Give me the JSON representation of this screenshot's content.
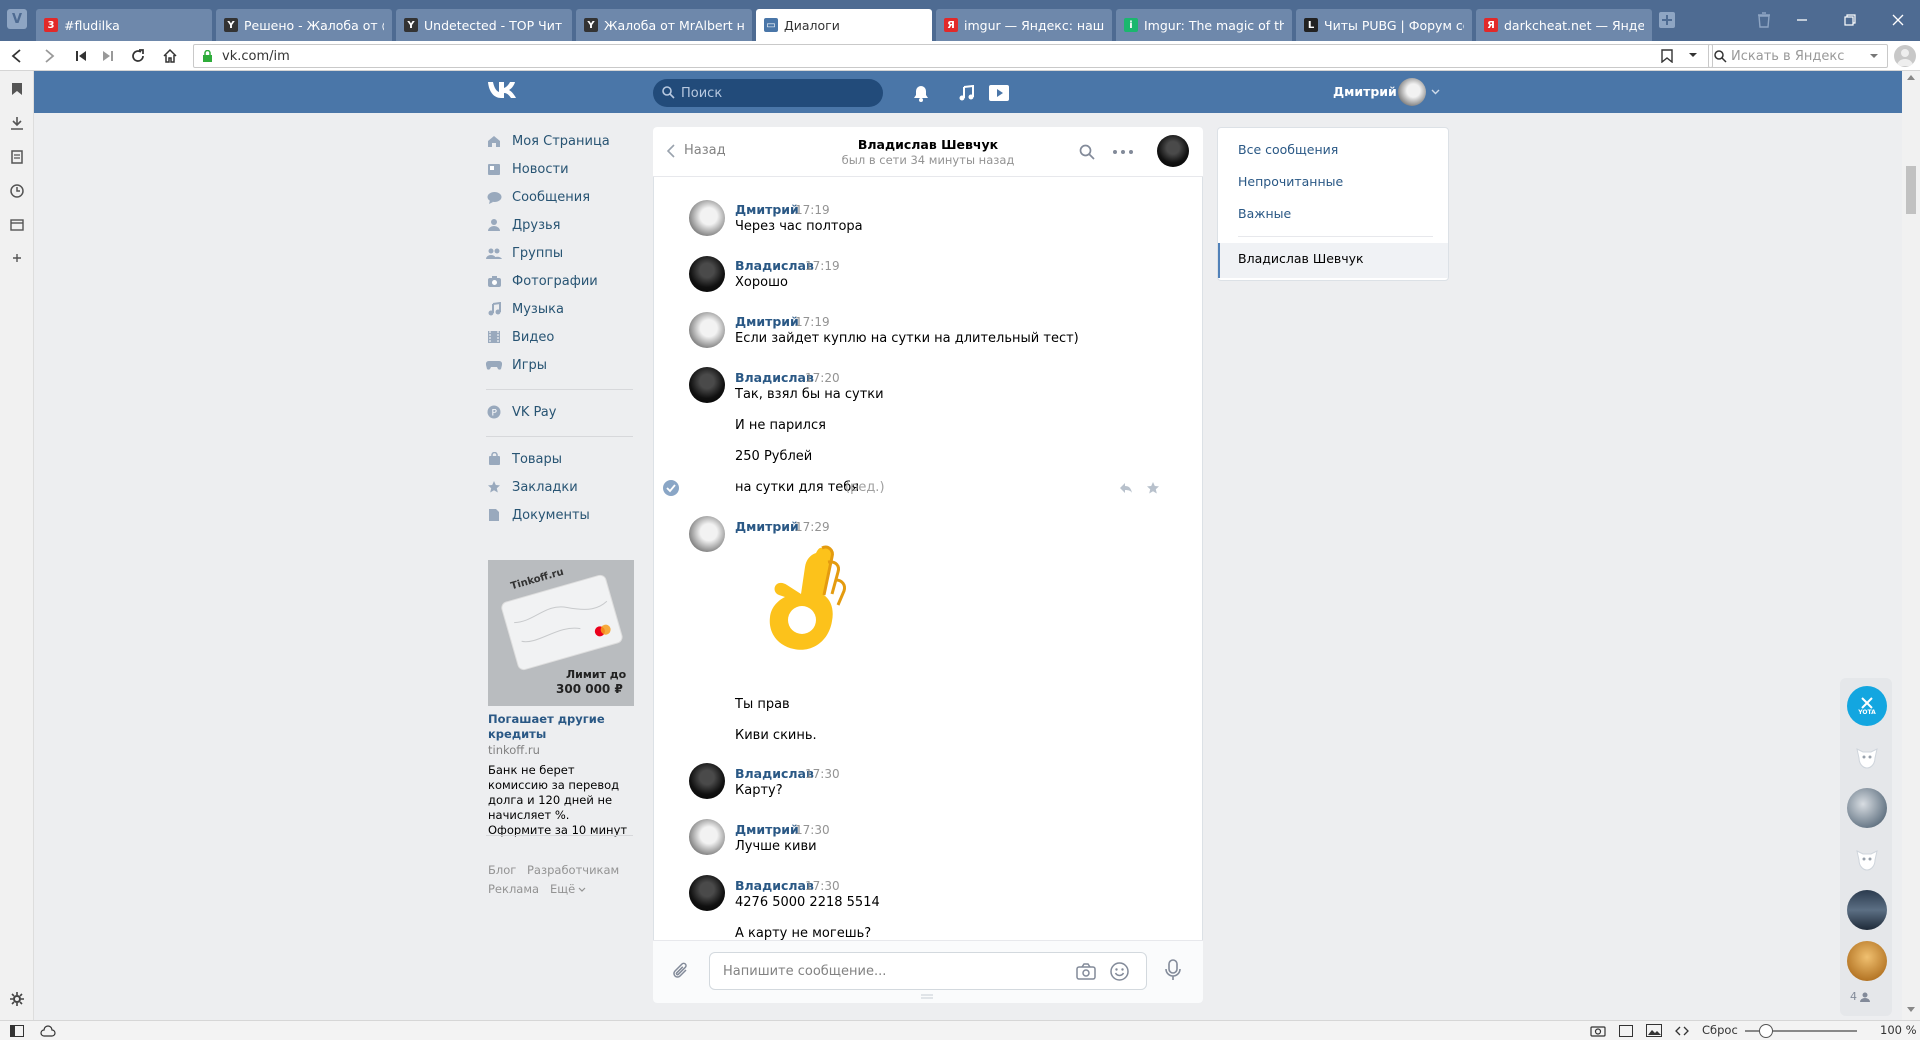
{
  "browser": {
    "tabs": [
      {
        "title": "#fludilka",
        "favicon_color": "#e22929",
        "favicon_char": "3"
      },
      {
        "title": "Решено - Жалоба от @KAI",
        "favicon_color": "#333333",
        "favicon_char": "Y"
      },
      {
        "title": "Undetected - TOP Чит для",
        "favicon_color": "#333333",
        "favicon_char": "Y"
      },
      {
        "title": "Жалоба от MrAlbert на DK",
        "favicon_color": "#333333",
        "favicon_char": "Y"
      },
      {
        "title": "Диалоги",
        "favicon_color": "#4a76a8",
        "favicon_char": "▭"
      },
      {
        "title": "imgur — Яндекс: нашлось",
        "favicon_color": "#e22929",
        "favicon_char": "Я"
      },
      {
        "title": "Imgur: The magic of the Int",
        "favicon_color": "#1bb76e",
        "favicon_char": "i"
      },
      {
        "title": "Читы PUBG | Форум социа",
        "favicon_color": "#222222",
        "favicon_char": "L"
      },
      {
        "title": "darkcheat.net — Яндекс: на",
        "favicon_color": "#e22929",
        "favicon_char": "Я"
      }
    ],
    "url": "vk.com/im",
    "search_placeholder": "Искать в Яндекс",
    "zoom": "100 %",
    "reset_label": "Сброс"
  },
  "vk": {
    "search_placeholder": "Поиск",
    "user_name": "Дмитрий",
    "menu": [
      {
        "label": "Моя Страница",
        "icon": "home-icon"
      },
      {
        "label": "Новости",
        "icon": "news-icon"
      },
      {
        "label": "Сообщения",
        "icon": "messages-icon"
      },
      {
        "label": "Друзья",
        "icon": "friends-icon"
      },
      {
        "label": "Группы",
        "icon": "groups-icon"
      },
      {
        "label": "Фотографии",
        "icon": "camera-icon"
      },
      {
        "label": "Музыка",
        "icon": "music-icon"
      },
      {
        "label": "Видео",
        "icon": "video-icon"
      },
      {
        "label": "Игры",
        "icon": "gamepad-icon"
      }
    ],
    "menu2": [
      {
        "label": "VK Pay",
        "icon": "vkpay-icon"
      }
    ],
    "menu3": [
      {
        "label": "Товары",
        "icon": "bag-icon"
      },
      {
        "label": "Закладки",
        "icon": "star-icon"
      },
      {
        "label": "Документы",
        "icon": "doc-icon"
      }
    ],
    "ad": {
      "card_brand": "Tinkoff.ru",
      "card_limit_line1": "Лимит до",
      "card_limit_line2": "300 000 ₽",
      "title": "Погашает другие кредиты",
      "domain": "tinkoff.ru",
      "text": "Банк не берет комиссию за перевод долга и 120 дней не начисляет %. Оформите за 10 минут"
    },
    "footer": {
      "blog": "Блог",
      "dev": "Разработчикам",
      "ads": "Реклама",
      "more": "Ещё"
    }
  },
  "chat": {
    "back_label": "Назад",
    "peer_name": "Владислав Шевчук",
    "peer_status": "был в сети 34 минуты назад",
    "input_placeholder": "Напишите сообщение...",
    "edited_label": "(ред.)",
    "messages": [
      {
        "author": "Дмитрий",
        "time": "17:19",
        "lines": [
          "Через час полтора"
        ]
      },
      {
        "author": "Владислав",
        "time": "17:19",
        "lines": [
          "Хорошо"
        ]
      },
      {
        "author": "Дмитрий",
        "time": "17:19",
        "lines": [
          "Если зайдет куплю на сутки на длительный тест)"
        ]
      },
      {
        "author": "Владислав",
        "time": "17:20",
        "lines": [
          "Так, взял бы на сутки",
          "И не парился",
          "250 Рублей",
          "на сутки для тебя"
        ]
      },
      {
        "author": "Дмитрий",
        "time": "17:29",
        "lines": [
          "👌",
          "Ты прав",
          "Киви скинь."
        ]
      },
      {
        "author": "Владислав",
        "time": "17:30",
        "lines": [
          "Карту?"
        ]
      },
      {
        "author": "Дмитрий",
        "time": "17:30",
        "lines": [
          "Лучше киви"
        ]
      },
      {
        "author": "Владислав",
        "time": "17:30",
        "lines": [
          "4276 5000 2218 5514",
          "А карту не могешь?"
        ]
      }
    ]
  },
  "filters": {
    "all": "Все сообщения",
    "unread": "Непрочитанные",
    "important": "Важные",
    "selected": "Владислав Шевчук"
  },
  "floating": {
    "yota_label": "YOTA",
    "count": "4"
  },
  "colors": {
    "vk_blue": "#4a76a8",
    "link": "#2a5885",
    "browser_tabbar": "#4e6b92"
  }
}
